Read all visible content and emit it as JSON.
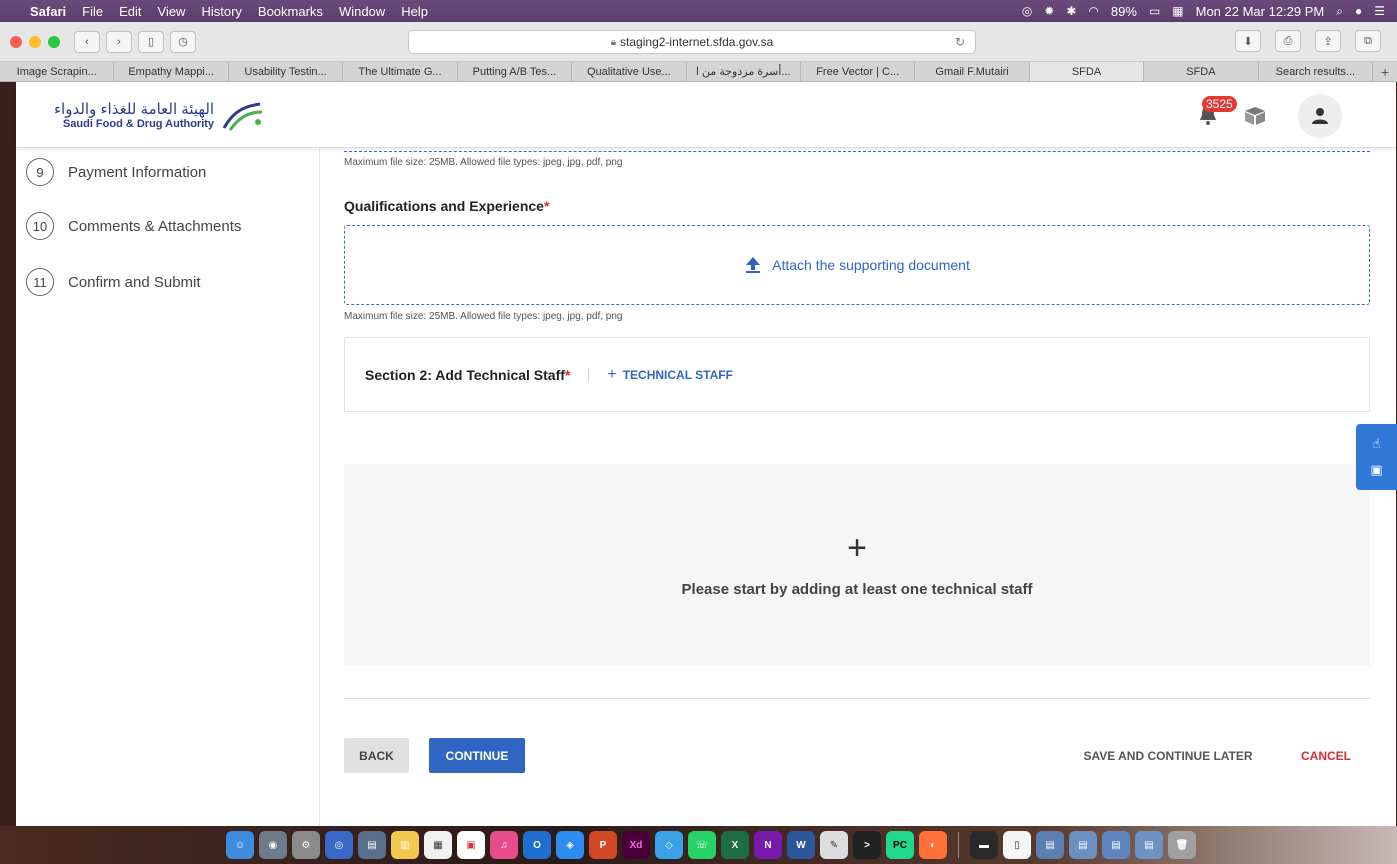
{
  "menubar": {
    "app": "Safari",
    "items": [
      "File",
      "Edit",
      "View",
      "History",
      "Bookmarks",
      "Window",
      "Help"
    ],
    "battery": "89%",
    "datetime": "Mon 22 Mar  12:29 PM"
  },
  "browser": {
    "url": "staging2-internet.sfda.gov.sa",
    "tabs": [
      {
        "label": "Image Scrapin..."
      },
      {
        "label": "Empathy Mappi..."
      },
      {
        "label": "Usability Testin..."
      },
      {
        "label": "The Ultimate G..."
      },
      {
        "label": "Putting A/B Tes..."
      },
      {
        "label": "Qualitative Use..."
      },
      {
        "label": "أسرة مزدوجة من ا..."
      },
      {
        "label": "Free Vector | C..."
      },
      {
        "label": "Gmail F.Mutairi"
      },
      {
        "label": "SFDA"
      },
      {
        "label": "SFDA"
      },
      {
        "label": "Search results..."
      }
    ]
  },
  "header": {
    "logo_ar": "الهيئة العامة للغذاء والدواء",
    "logo_en": "Saudi Food & Drug Authority",
    "notification_count": "3525"
  },
  "sidebar": {
    "steps": [
      {
        "num": "9",
        "label": "Payment Information"
      },
      {
        "num": "10",
        "label": "Comments & Attachments"
      },
      {
        "num": "11",
        "label": "Confirm and Submit"
      }
    ]
  },
  "form": {
    "file_hint": "Maximum file size: 25MB. Allowed file types: jpeg, jpg, pdf, png",
    "qualifications_label": "Qualifications and Experience",
    "required_mark": "*",
    "attach_label": "Attach the supporting document",
    "section2_title": "Section 2: Add Technical Staff",
    "add_staff_label": "TECHNICAL STAFF",
    "empty_message": "Please start by adding at least one technical staff"
  },
  "actions": {
    "back": "BACK",
    "continue": "CONTINUE",
    "save_later": "SAVE AND CONTINUE LATER",
    "cancel": "CANCEL"
  },
  "colors": {
    "primary": "#2f66c4",
    "danger": "#d32f2f",
    "badge": "#e53935"
  }
}
